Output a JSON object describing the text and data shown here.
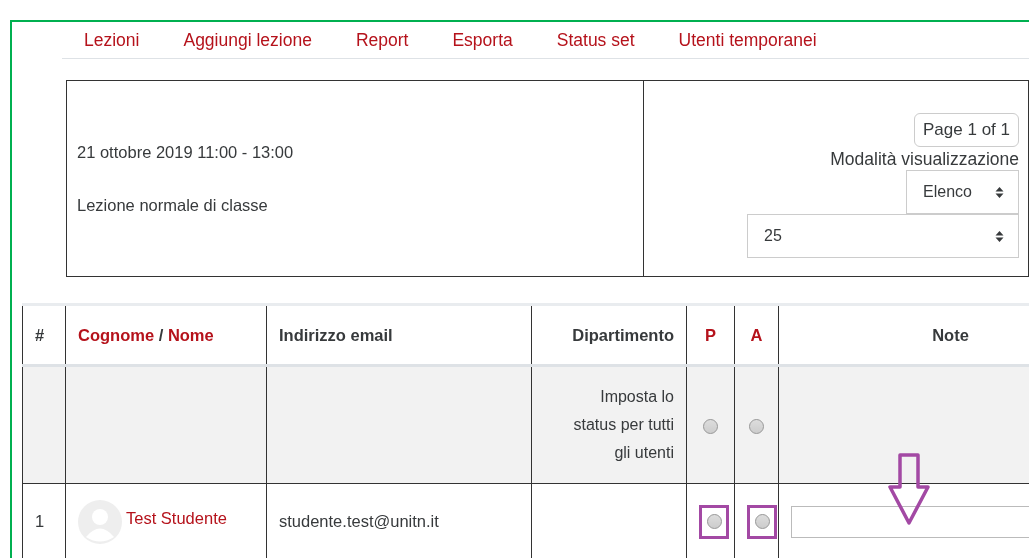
{
  "nav": [
    {
      "label": "Lezioni"
    },
    {
      "label": "Aggiungi lezione"
    },
    {
      "label": "Report"
    },
    {
      "label": "Esporta"
    },
    {
      "label": "Status set"
    },
    {
      "label": "Utenti temporanei"
    }
  ],
  "session": {
    "date": "21 ottobre 2019 11:00 - 13:00",
    "description": "Lezione normale di classe"
  },
  "controls": {
    "pager": "Page 1 of 1",
    "view_label": "Modalità visualizzazione",
    "view_select": "Elenco",
    "per_page_select": "25"
  },
  "table": {
    "columns": [
      {
        "kind": "plain",
        "label": "#"
      },
      {
        "kind": "sort",
        "first": "Cognome",
        "separator": "/",
        "second": "Nome"
      },
      {
        "kind": "plain",
        "label": "Indirizzo email"
      },
      {
        "kind": "plain",
        "label": "Dipartimento"
      },
      {
        "kind": "link",
        "label": "P"
      },
      {
        "kind": "link",
        "label": "A"
      },
      {
        "kind": "plain",
        "label": "Note"
      }
    ],
    "set_all": {
      "label": "Imposta lo status per tutti gli utenti",
      "p": {
        "selected": false
      },
      "a": {
        "selected": false
      }
    },
    "rows": [
      {
        "number": "1",
        "name": "Test Studente",
        "email": "studente.test@unitn.it",
        "p": {
          "selected": false
        },
        "a": {
          "selected": false
        },
        "note": ""
      }
    ]
  }
}
